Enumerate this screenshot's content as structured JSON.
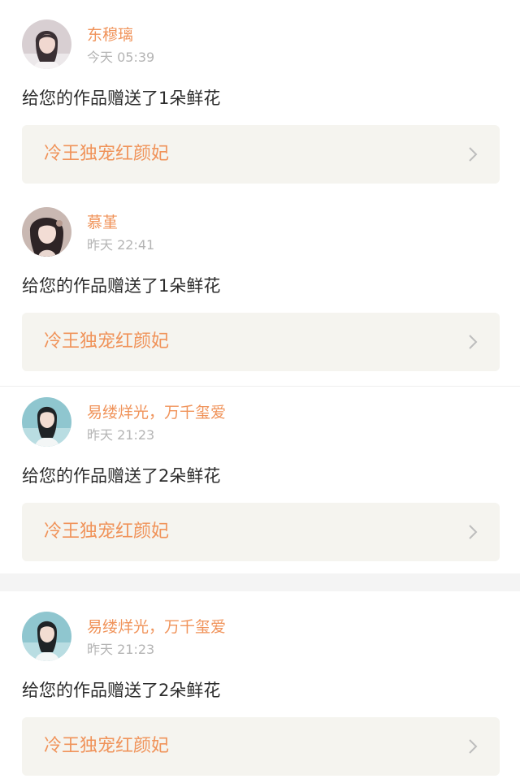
{
  "notifications": [
    {
      "username": "东穆璃",
      "time": "今天 05:39",
      "message": "给您的作品赠送了1朵鲜花",
      "work_title": "冷王独宠红颜妃"
    },
    {
      "username": "慕堇",
      "time": "昨天 22:41",
      "message": "给您的作品赠送了1朵鲜花",
      "work_title": "冷王独宠红颜妃"
    },
    {
      "username": "易缕烊光，万千玺爱",
      "time": "昨天 21:23",
      "message": "给您的作品赠送了2朵鲜花",
      "work_title": "冷王独宠红颜妃"
    },
    {
      "username": "易缕烊光，万千玺爱",
      "time": "昨天 21:23",
      "message": "给您的作品赠送了2朵鲜花",
      "work_title": "冷王独宠红颜妃"
    }
  ],
  "colors": {
    "accent": "#f0935a",
    "timestamp": "#b4b4b4",
    "text": "#2c2c2c",
    "link_background": "#f5f4ef",
    "separator": "#f4f4f4"
  },
  "icons": {
    "chevron": "chevron-right-icon"
  }
}
